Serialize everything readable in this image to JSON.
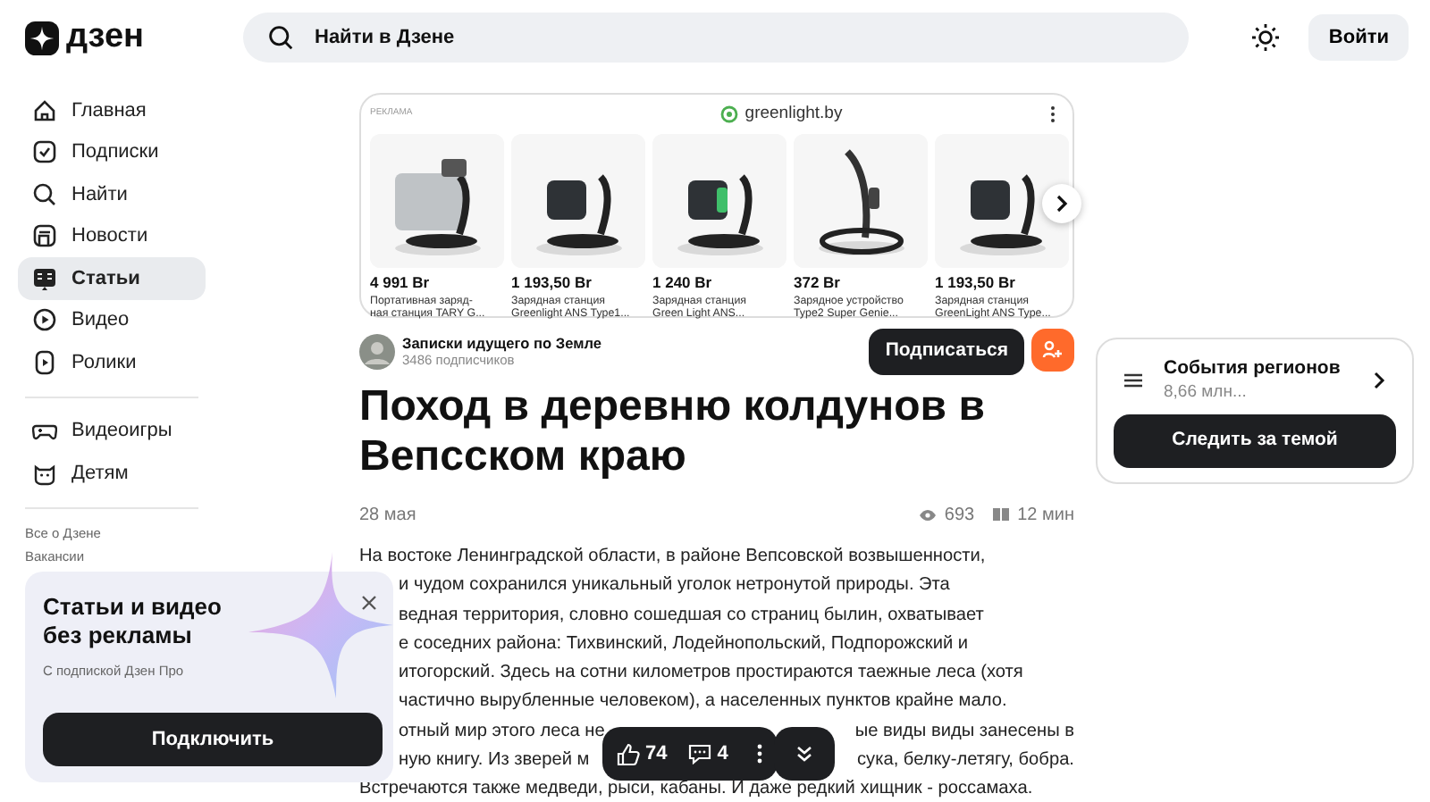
{
  "header": {
    "logo": "дзен",
    "search": {
      "placeholder": "Найти в Дзене"
    },
    "login": "Войти"
  },
  "sidebar": {
    "main": [
      {
        "label": "Главная",
        "kind": "home",
        "selected": false
      },
      {
        "label": "Подписки",
        "kind": "subs",
        "selected": false
      },
      {
        "label": "Найти",
        "kind": "search",
        "selected": false
      },
      {
        "label": "Новости",
        "kind": "news",
        "selected": false
      },
      {
        "label": "Статьи",
        "kind": "articles",
        "selected": true
      },
      {
        "label": "Видео",
        "kind": "video",
        "selected": false
      },
      {
        "label": "Ролики",
        "kind": "clips",
        "selected": false
      }
    ],
    "extra": [
      {
        "label": "Видеоигры",
        "kind": "games",
        "selected": false
      },
      {
        "label": "Детям",
        "kind": "kids",
        "selected": false
      }
    ],
    "links": [
      "Все о Дзене",
      "Вакансии"
    ]
  },
  "ad": {
    "label": "РЕКЛАМА",
    "advertiser": "greenlight.by",
    "products": [
      {
        "price": "4 991 Br",
        "description": [
          "Портативная заряд-",
          "ная станция TARY G..."
        ]
      },
      {
        "price": "1 193,50 Br",
        "description": [
          "Зарядная станция",
          "Greenlight ANS Type1..."
        ]
      },
      {
        "price": "1 240 Br",
        "description": [
          "Зарядная станция",
          "Green Light ANS..."
        ]
      },
      {
        "price": "372 Br",
        "description": [
          "Зарядное устройство",
          "Type2 Super Genie..."
        ]
      },
      {
        "price": "1 193,50 Br",
        "description": [
          "Зарядная станция",
          "GreenLight ANS Type..."
        ]
      }
    ]
  },
  "article": {
    "channel": {
      "name": "Записки идущего по Земле",
      "subscribers": "3486 подписчиков"
    },
    "subscribe": "Подписаться",
    "title": "Поход в деревню колдунов в Вепсском краю",
    "date": "28 мая",
    "views": "693",
    "read_time": "12 мин",
    "lines": [
      {
        "covered": false,
        "segments": [
          "На востоке Ленинградской области, в районе Вепсовской возвышенности,"
        ]
      },
      {
        "covered": true,
        "segments": [
          "и чудом сохранился уникальный уголок нетронутой природы. Эта"
        ]
      },
      {
        "covered": true,
        "segments": [
          "ведная территория, словно сошедшая со страниц былин, охватывает"
        ]
      },
      {
        "covered": true,
        "segments": [
          "е соседних района: Тихвинский, Лодейнопольский, Подпорожский и"
        ]
      },
      {
        "covered": true,
        "segments": [
          "итогорский. Здесь на сотни километров простираются таежные леса (хотя"
        ]
      },
      {
        "covered": true,
        "segments": [
          "частично вырубленные человеком), а населенных пунктов крайне мало."
        ]
      },
      {
        "covered": true,
        "segments": [
          "отный мир этого леса не",
          "ые виды виды занесены в"
        ]
      },
      {
        "covered": true,
        "segments": [
          "ную книгу. Из зверей м",
          "сука, белку-летягу, бобра."
        ]
      },
      {
        "covered": false,
        "segments": [
          "Встречаются также медведи, рыси, кабаны. И даже редкий хищник - россамаха."
        ]
      }
    ]
  },
  "topic": {
    "title": "События регионов",
    "count": "8,66 млн...",
    "follow": "Следить за темой"
  },
  "promo": {
    "title": "Статьи и видео без рекламы",
    "subtitle": "С подпиской Дзен Про",
    "button": "Подключить"
  },
  "action_bar": {
    "likes": "74",
    "comments": "4"
  }
}
